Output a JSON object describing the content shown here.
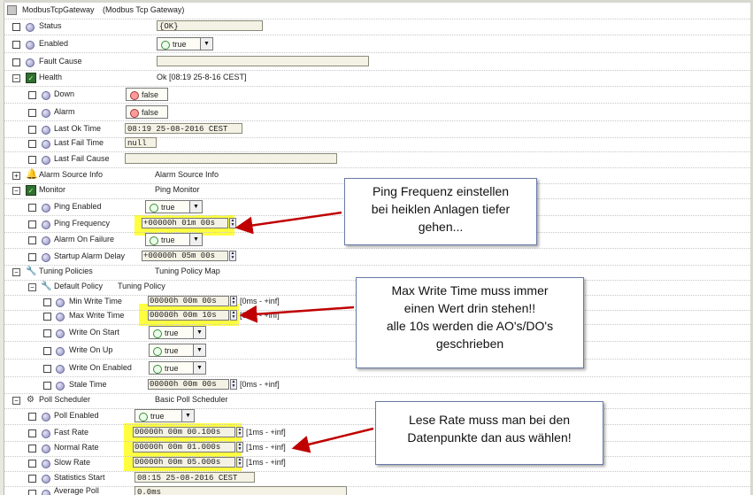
{
  "header": {
    "title": "ModbusTcpGateway",
    "subtitle": "(Modbus Tcp Gateway)"
  },
  "rows": {
    "status": {
      "label": "Status",
      "value": "{OK}"
    },
    "enabled": {
      "label": "Enabled",
      "value": "true"
    },
    "fault_cause": {
      "label": "Fault Cause",
      "value": ""
    },
    "health": {
      "label": "Health",
      "value": "Ok [08:19 25-8-16 CEST]"
    },
    "down": {
      "label": "Down",
      "value": "false"
    },
    "alarm": {
      "label": "Alarm",
      "value": "false"
    },
    "last_ok_time": {
      "label": "Last Ok Time",
      "value": "08:19 25-08-2016 CEST"
    },
    "last_fail_time": {
      "label": "Last Fail Time",
      "value": "null"
    },
    "last_fail_cause": {
      "label": "Last Fail Cause",
      "value": ""
    },
    "alarm_source_info": {
      "label": "Alarm Source Info",
      "value": "Alarm Source Info"
    },
    "monitor": {
      "label": "Monitor",
      "value": "Ping Monitor"
    },
    "ping_enabled": {
      "label": "Ping Enabled",
      "value": "true"
    },
    "ping_frequency": {
      "label": "Ping Frequency",
      "value": "+00000h 01m 00s"
    },
    "alarm_on_failure": {
      "label": "Alarm On Failure",
      "value": "true"
    },
    "startup_alarm_delay": {
      "label": "Startup Alarm Delay",
      "value": "+00000h 05m 00s"
    },
    "tuning_policies": {
      "label": "Tuning Policies",
      "value": "Tuning Policy Map"
    },
    "default_policy": {
      "label": "Default Policy",
      "value": "Tuning Policy"
    },
    "min_write_time": {
      "label": "Min Write Time",
      "value": "00000h 00m 00s",
      "range": "[0ms - +inf]"
    },
    "max_write_time": {
      "label": "Max Write Time",
      "value": "00000h 00m 10s",
      "range": "[0ms - +inf]"
    },
    "write_on_start": {
      "label": "Write On Start",
      "value": "true"
    },
    "write_on_up": {
      "label": "Write On Up",
      "value": "true"
    },
    "write_on_enabled": {
      "label": "Write On Enabled",
      "value": "true"
    },
    "stale_time": {
      "label": "Stale Time",
      "value": "00000h 00m 00s",
      "range": "[0ms - +inf]"
    },
    "poll_scheduler": {
      "label": "Poll Scheduler",
      "value": "Basic Poll Scheduler"
    },
    "poll_enabled": {
      "label": "Poll Enabled",
      "value": "true"
    },
    "fast_rate": {
      "label": "Fast Rate",
      "value": "00000h 00m 00.100s",
      "range": "[1ms - +inf]"
    },
    "normal_rate": {
      "label": "Normal Rate",
      "value": "00000h 00m 01.000s",
      "range": "[1ms - +inf]"
    },
    "slow_rate": {
      "label": "Slow Rate",
      "value": "00000h 00m 05.000s",
      "range": "[1ms - +inf]"
    },
    "statistics_start": {
      "label": "Statistics Start",
      "value": "08:15 25-08-2016 CEST"
    },
    "average_poll": {
      "label": "Average Poll",
      "value": "0.0ms"
    }
  },
  "callouts": {
    "ping": [
      "Ping Frequenz einstellen",
      "bei heiklen Anlagen tiefer",
      "gehen..."
    ],
    "write": [
      "Max Write Time muss immer",
      "einen Wert drin stehen!!",
      "alle 10s werden die AO's/DO's",
      "geschrieben"
    ],
    "read": [
      "Lese Rate muss man bei den",
      "Datenpunkte dan aus wählen!"
    ]
  },
  "colors": {
    "highlight": "#ffff40",
    "arrow": "#c00000",
    "callout_border": "#6a7aa8"
  }
}
